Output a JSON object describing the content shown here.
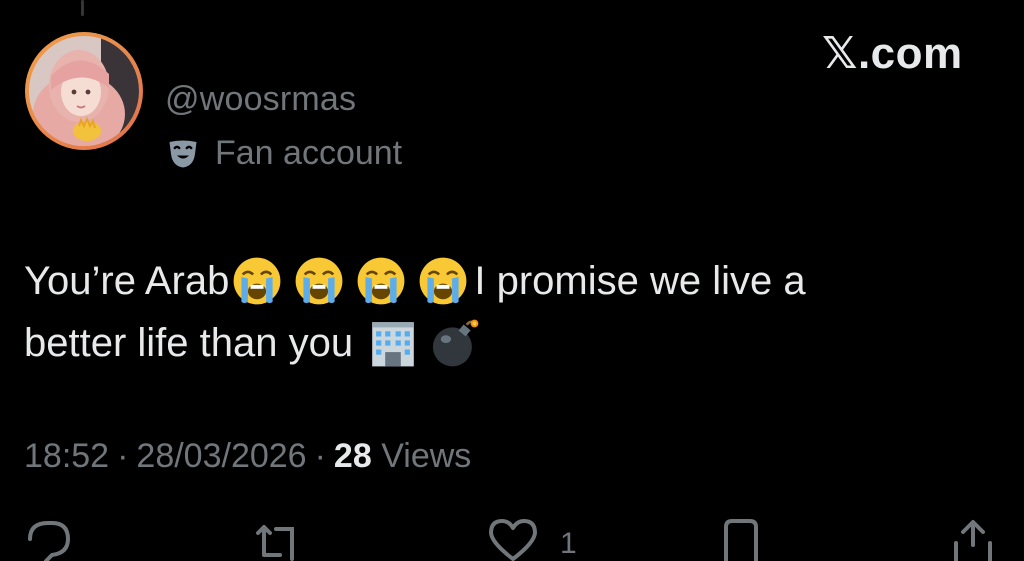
{
  "author": {
    "handle": "@woosrmas",
    "label_text": "Fan account",
    "label_icon": "theater-mask-icon",
    "avatar": "profile-photo"
  },
  "brand": "𝕏.com",
  "tweet": {
    "text_part1": "You’re Arab",
    "text_part2": "I promise we live a",
    "text_line2": "better life than you",
    "emojis_line1": [
      "loudly-crying-face",
      "loudly-crying-face",
      "loudly-crying-face",
      "loudly-crying-face"
    ],
    "emojis_line2": [
      "office-building",
      "bomb"
    ]
  },
  "meta": {
    "time": "18:52",
    "separator": "·",
    "date": "28/03/2026",
    "views_count": "28",
    "views_label": "Views"
  },
  "actions": {
    "reply_icon": "reply-icon",
    "repost_icon": "repost-icon",
    "like_icon": "heart-icon",
    "like_count": "1",
    "bookmark_icon": "bookmark-icon",
    "share_icon": "share-icon"
  },
  "colors": {
    "background": "#000000",
    "primary_text": "#e7e9ea",
    "secondary_text": "#71767b",
    "avatar_ring": "#f0a04a"
  }
}
